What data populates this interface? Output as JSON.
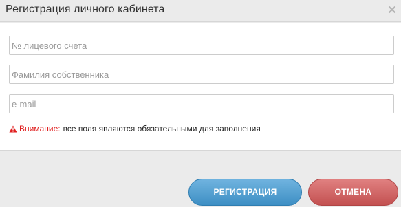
{
  "dialog": {
    "title": "Регистрация личного кабинета",
    "close_icon": "close-icon"
  },
  "form": {
    "account_number": {
      "value": "",
      "placeholder": "№ лицевого счета"
    },
    "owner_surname": {
      "value": "",
      "placeholder": "Фамилия собственника"
    },
    "email": {
      "value": "",
      "placeholder": "e-mail"
    }
  },
  "warning": {
    "icon": "warning-triangle-icon",
    "label": "Внимание:",
    "text": "все поля являются обязательными для заполнения",
    "label_color": "#e01e1e"
  },
  "buttons": {
    "register_label": "РЕГИСТРАЦИЯ",
    "cancel_label": "ОТМЕНА",
    "register_color": "#4a9ad0",
    "cancel_color": "#d06464"
  }
}
